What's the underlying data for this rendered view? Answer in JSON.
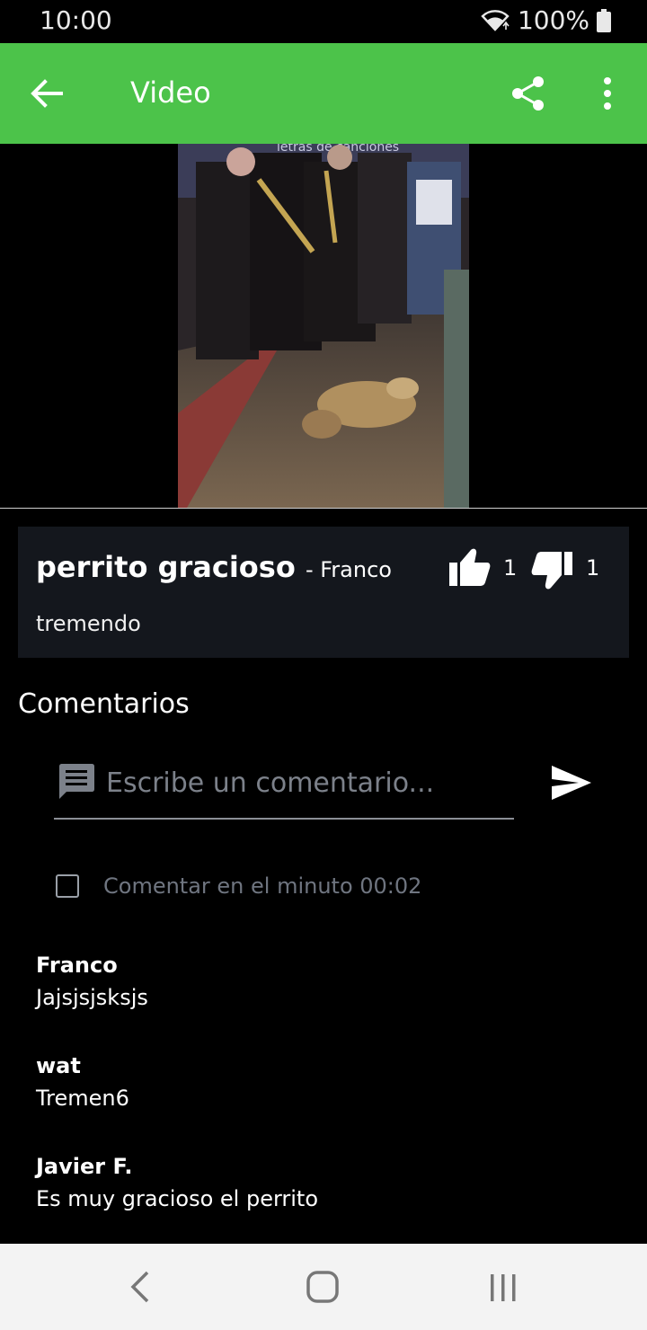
{
  "status_bar": {
    "time": "10:00",
    "battery": "100%",
    "wifi_icon": "wifi-icon",
    "battery_icon": "battery-icon"
  },
  "app_bar": {
    "title": "Video",
    "color": "#4cc34a",
    "icons": [
      "back-arrow-icon",
      "share-icon",
      "more-vert-icon"
    ]
  },
  "video": {
    "overlay_text": "letras de canciones"
  },
  "video_info": {
    "title": "perrito gracioso",
    "author": "- Franco",
    "description": "tremendo",
    "likes": "1",
    "dislikes": "1"
  },
  "comments_section": {
    "title": "Comentarios",
    "input_placeholder": "Escribe un comentario...",
    "checkbox_label": "Comentar en el minuto 00:02",
    "checkbox_checked": false
  },
  "comments": [
    {
      "author": "Franco",
      "text": "Jajsjsjsksjs"
    },
    {
      "author": "wat",
      "text": "Tremen6"
    },
    {
      "author": "Javier F.",
      "text": "Es muy gracioso el perrito"
    }
  ],
  "nav_bar": {
    "icons": [
      "nav-back-icon",
      "nav-home-icon",
      "nav-recents-icon"
    ]
  }
}
